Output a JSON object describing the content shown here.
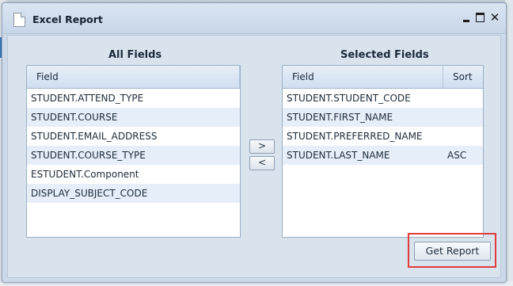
{
  "window": {
    "title": "Excel Report",
    "close_glyph": "✕"
  },
  "left_panel": {
    "heading": "All Fields",
    "column_field": "Field",
    "rows": [
      {
        "field": "STUDENT.ATTEND_TYPE"
      },
      {
        "field": "STUDENT.COURSE"
      },
      {
        "field": "STUDENT.EMAIL_ADDRESS"
      },
      {
        "field": "STUDENT.COURSE_TYPE"
      },
      {
        "field": "ESTUDENT.Component"
      },
      {
        "field": "DISPLAY_SUBJECT_CODE"
      }
    ]
  },
  "right_panel": {
    "heading": "Selected Fields",
    "column_field": "Field",
    "column_sort": "Sort",
    "rows": [
      {
        "field": "STUDENT.STUDENT_CODE",
        "sort": ""
      },
      {
        "field": "STUDENT.FIRST_NAME",
        "sort": ""
      },
      {
        "field": "STUDENT.PREFERRED_NAME",
        "sort": ""
      },
      {
        "field": "STUDENT.LAST_NAME",
        "sort": "ASC"
      }
    ]
  },
  "buttons": {
    "move_right": ">",
    "move_left": "<",
    "get_report": "Get Report"
  },
  "colors": {
    "highlight": "#e03c3c",
    "alt_row": "#e5eef9",
    "accent_left_block": "#3a7bbf"
  }
}
